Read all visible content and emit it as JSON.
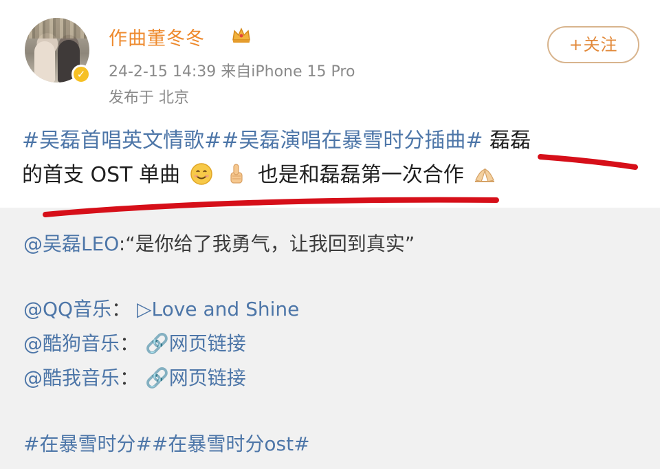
{
  "author": {
    "name": "作曲董冬冬",
    "timestamp": "24-2-15 14:39",
    "source": "来自iPhone 15 Pro",
    "location": "发布于 北京",
    "follow_label": "+关注"
  },
  "post": {
    "tag1": "#吴磊首唱英文情歌#",
    "tag2": "#吴磊演唱在暴雪时分插曲#",
    "text1": " 磊磊",
    "text2": "的首支 OST 单曲",
    "text3": "也是和磊磊第一次合作"
  },
  "quote": {
    "line1_at": "@吴磊LEO",
    "line1_text": ":“是你给了我勇气，让我回到真实”",
    "qq_at": "@QQ音乐",
    "qq_sep": "：",
    "qq_link": "▷Love and Shine",
    "kugou_at": "@酷狗音乐",
    "kugou_sep": "：",
    "kugou_link": "🔗网页链接",
    "kuwo_at": "@酷我音乐",
    "kuwo_sep": "：",
    "kuwo_link": "🔗网页链接",
    "tags": "#在暴雪时分##在暴雪时分ost#"
  },
  "icons": {
    "avatar": "avatar",
    "verified": "verified-badge-icon",
    "crown": "crown-icon",
    "smile": "smile-emoji-icon",
    "thumb": "thumbs-up-emoji-icon",
    "pray": "pray-emoji-icon"
  },
  "colors": {
    "username": "#ee8a2e",
    "hashtag": "#4d76a8",
    "follow_border": "#d8b48d",
    "annotation": "#d60f19",
    "quote_bg": "#f1f1f1"
  }
}
